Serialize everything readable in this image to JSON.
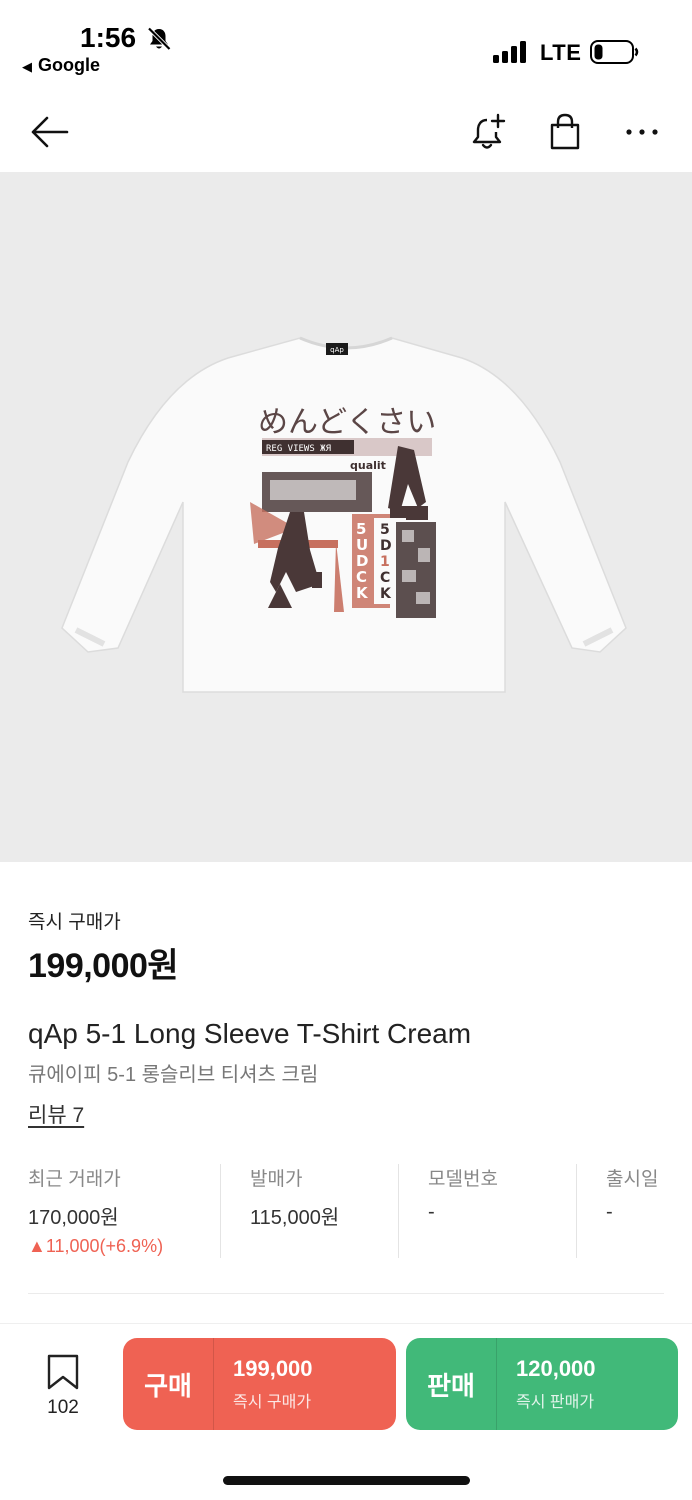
{
  "status_bar": {
    "time": "1:56",
    "back_app": "Google",
    "network": "LTE",
    "icons": [
      "bell-slash-icon",
      "signal-icon",
      "battery-icon"
    ]
  },
  "nav": {
    "icons": [
      "back-arrow-icon",
      "bell-plus-icon",
      "shopping-bag-icon",
      "more-icon"
    ]
  },
  "product": {
    "instant_buy_label": "즉시 구매가",
    "price": "199,000원",
    "name_en": "qAp 5-1 Long Sleeve T-Shirt Cream",
    "name_ko": "큐에이피 5-1 롱슬리브 티셔츠 크림",
    "review": "리뷰 7",
    "image_print": {
      "title": "めんどくさい",
      "banner": "REG VIEWS ЖЯ",
      "tag": "qualit",
      "stamp": [
        "5",
        "U",
        "D",
        "C",
        "K"
      ],
      "stamp2": [
        "5",
        "D",
        "1",
        "C",
        "K"
      ],
      "collar_tag": "qAp"
    }
  },
  "stats": [
    {
      "label": "최근 거래가",
      "value": "170,000원",
      "change": "▲11,000(+6.9%)"
    },
    {
      "label": "발매가",
      "value": "115,000원"
    },
    {
      "label": "모델번호",
      "value": "-"
    },
    {
      "label": "출시일",
      "value": "-"
    }
  ],
  "bottom_bar": {
    "wish_count": "102",
    "buy": {
      "label": "구매",
      "price": "199,000",
      "sub": "즉시 구매가"
    },
    "sell": {
      "label": "판매",
      "price": "120,000",
      "sub": "즉시 판매가"
    }
  },
  "colors": {
    "buy": "#ef6253",
    "sell": "#41b979",
    "image_bg": "#ebebeb",
    "change_up": "#ef6253"
  }
}
